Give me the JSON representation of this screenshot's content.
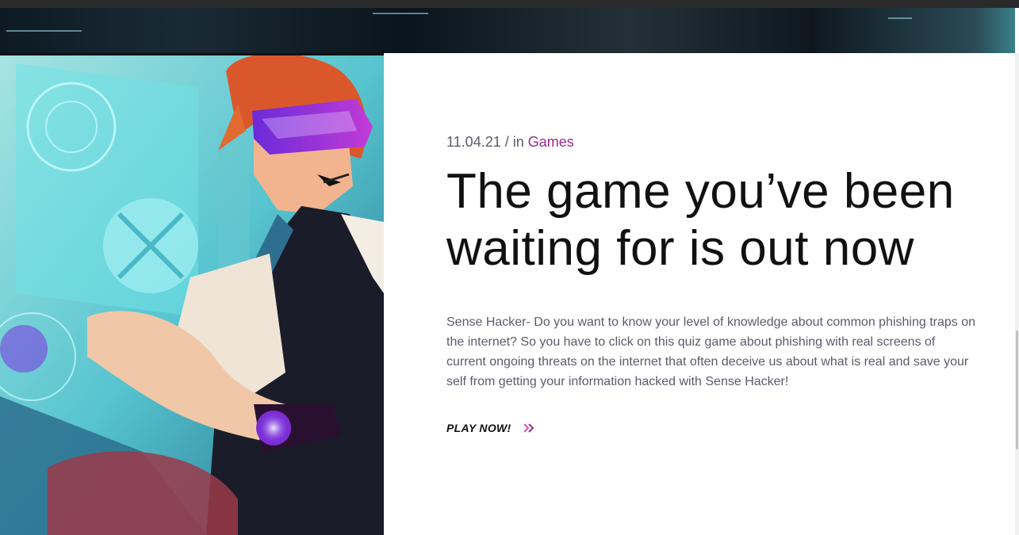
{
  "post": {
    "date": "11.04.21",
    "separator": " / in ",
    "category": "Games",
    "title": "The game you’ve been waiting for is out now",
    "excerpt": "Sense Hacker- Do you want to know your level of knowledge about common phishing traps on the internet? So you have to click on this quiz game about phishing with real screens of current ongoing threats on the internet that often deceive us about what is real and save your self from getting your information hacked with Sense Hacker!",
    "cta_label": "PLAY NOW!",
    "cta_icon": "double-chevron-right-icon"
  },
  "colors": {
    "accent": "#9b2a8f",
    "text_muted": "#5e5a6b",
    "heading": "#111111"
  }
}
